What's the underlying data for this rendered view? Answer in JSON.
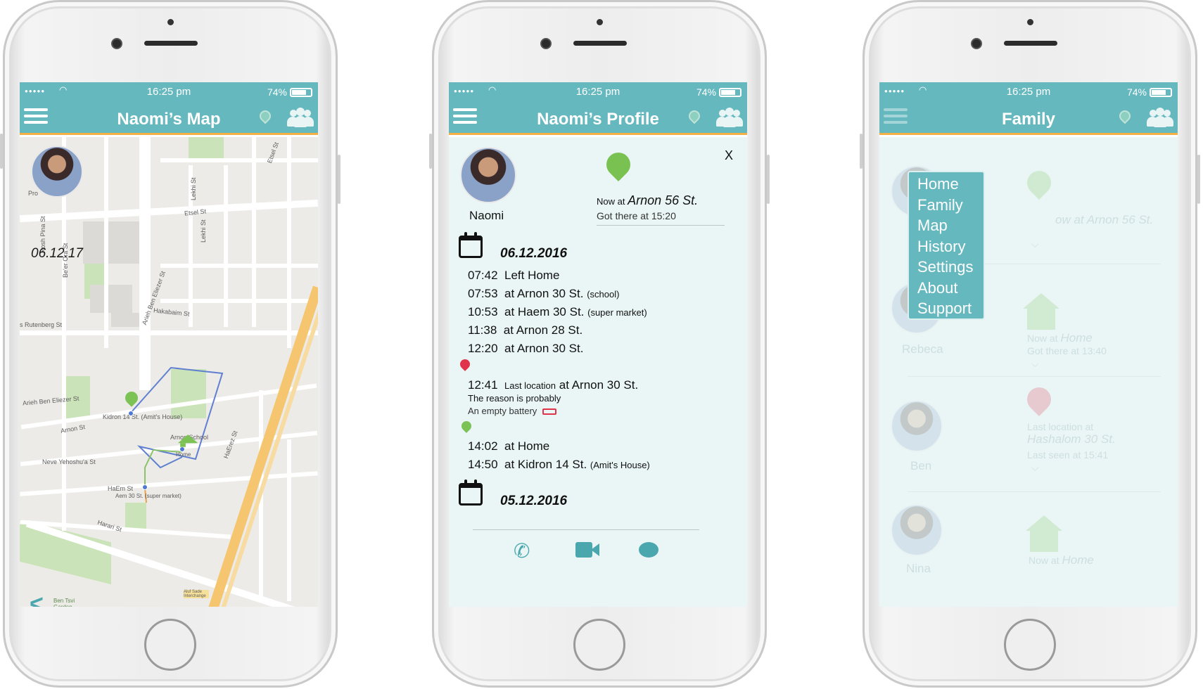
{
  "status": {
    "time": "16:25 pm",
    "battery": "74%"
  },
  "phone1": {
    "title": "Naomi’s Map",
    "date": "06.12.17",
    "labels": {
      "rosh_pina": "Rosh Pina St",
      "beer_ora": "Be'er Ora St",
      "rutenberg": "s Rutenberg St",
      "arieh": "Arieh Ben Eliezer St",
      "arieh2": "Arieh Ben Eliezer St",
      "lekhi": "Lekhi St",
      "etsel": "Etsel St",
      "etsel2": "Etsel St",
      "lekhi2": "Lekhi St",
      "hakabaim": "Hakabaim St",
      "kidron": "Kidron 14 St. (Amit's House)",
      "arnon": "Arnon St",
      "neve": "Neve Yehoshu'a St",
      "school": "Arnon School",
      "home": "Home",
      "haem": "HaEm St",
      "aem": "Aem 30 St. (super market)",
      "harari": "Harari St",
      "haerez": "HaErez St",
      "bentsvi": "Ben Tsvi Garden",
      "aluf": "Aluf Sade Interchange",
      "pro": "Pro"
    }
  },
  "phone2": {
    "title": "Naomi’s Profile",
    "close": "X",
    "name": "Naomi",
    "now_prefix": "Now at",
    "now_place": "Arnon 56 St.",
    "got_there": "Got there at 15:20",
    "date1": "06.12.2016",
    "entries": [
      {
        "time": "07:42",
        "text": "Left Home",
        "note": ""
      },
      {
        "time": "07:53",
        "text": "at Arnon 30 St.",
        "note": "(school)"
      },
      {
        "time": "10:53",
        "text": "at Haem 30 St.",
        "note": "(super market)"
      },
      {
        "time": "11:38",
        "text": "at Arnon 28 St.",
        "note": ""
      },
      {
        "time": "12:20",
        "text": "at Arnon 30 St.",
        "note": ""
      }
    ],
    "last": {
      "time": "12:41",
      "label": "Last location",
      "place": "at Arnon 30 St.",
      "reason1": "The reason is probably",
      "reason2": "An empty battery"
    },
    "entries2": [
      {
        "time": "14:02",
        "text": "at Home",
        "note": ""
      },
      {
        "time": "14:50",
        "text": "at Kidron 14 St.",
        "note": "(Amit's House)"
      }
    ],
    "date2": "05.12.2016"
  },
  "phone3": {
    "title": "Family",
    "menu": [
      "Home",
      "Family",
      "Map",
      "History",
      "Settings",
      "About",
      "Support"
    ],
    "members": [
      {
        "name": "",
        "line1": "ow at Arnon 56 St.",
        "line2": ""
      },
      {
        "name": "Rebeca",
        "line1_prefix": "Now at",
        "line1_place": "Home",
        "line2": "Got there at 13:40"
      },
      {
        "name": "Ben",
        "line1": "Last location at",
        "line1_place": "Hashalom 30 St.",
        "line2": "Last seen at 15:41"
      },
      {
        "name": "Nina",
        "line1_prefix": "Now at",
        "line1_place": "Home"
      }
    ]
  },
  "colors": {
    "teal": "#66b8bf",
    "accent": "#f2b045",
    "green": "#7cc255",
    "red": "#e0344a"
  }
}
